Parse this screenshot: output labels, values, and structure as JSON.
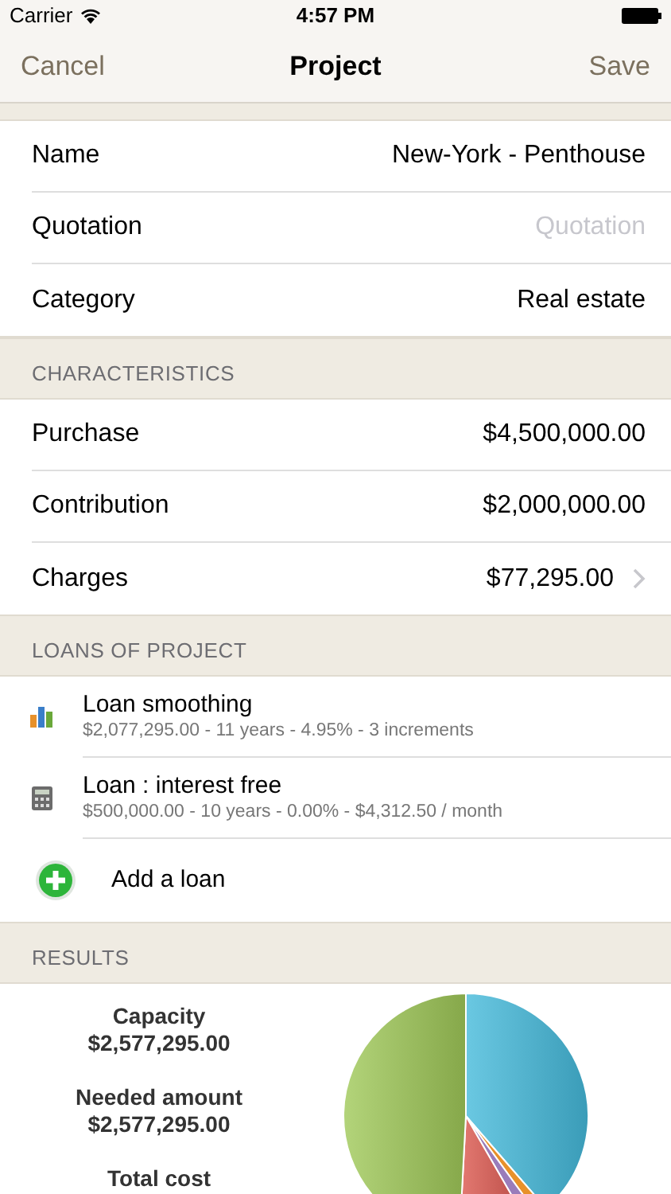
{
  "status_bar": {
    "carrier": "Carrier",
    "time": "4:57 PM"
  },
  "nav": {
    "left": "Cancel",
    "title": "Project",
    "right": "Save"
  },
  "fields": [
    {
      "label": "Name",
      "value": "New-York - Penthouse"
    },
    {
      "label": "Quotation",
      "placeholder": "Quotation"
    },
    {
      "label": "Category",
      "value": "Real estate"
    }
  ],
  "characteristics": {
    "header": "CHARACTERISTICS",
    "rows": [
      {
        "label": "Purchase",
        "value": "$4,500,000.00",
        "disclosure": false
      },
      {
        "label": "Contribution",
        "value": "$2,000,000.00",
        "disclosure": false
      },
      {
        "label": "Charges",
        "value": "$77,295.00",
        "disclosure": true
      }
    ]
  },
  "loans": {
    "header": "LOANS OF PROJECT",
    "items": [
      {
        "kind": "chart",
        "title": "Loan smoothing",
        "detail": "$2,077,295.00 - 11 years - 4.95% - 3 increments"
      },
      {
        "kind": "calculator",
        "title": "Loan : interest free",
        "detail": "$500,000.00 - 10 years - 0.00% - $4,312.50 / month"
      }
    ],
    "add": "Add a loan"
  },
  "results": {
    "header": "RESULTS",
    "items": [
      {
        "label": "Capacity",
        "value": "$2,577,295.00"
      },
      {
        "label": "Needed amount",
        "value": "$2,577,295.00"
      },
      {
        "label": "Total cost"
      }
    ]
  }
}
